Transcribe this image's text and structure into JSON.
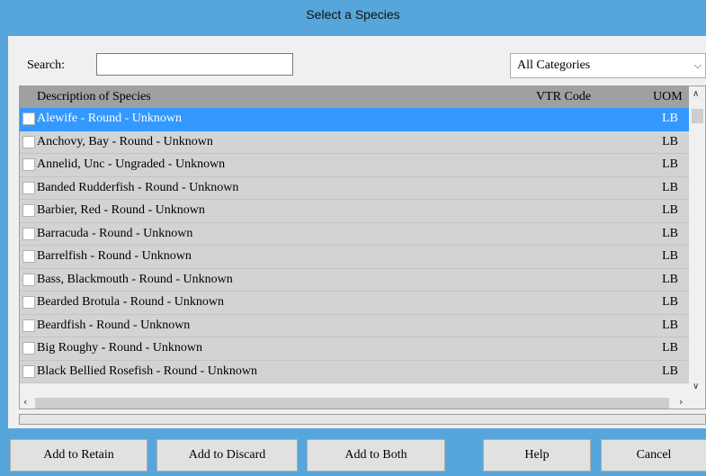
{
  "window": {
    "title": "Select a Species"
  },
  "search": {
    "label": "Search:",
    "value": "",
    "placeholder": ""
  },
  "category_filter": {
    "selected": "All Categories"
  },
  "table": {
    "columns": [
      "Description of Species",
      "VTR Code",
      "UOM"
    ],
    "rows": [
      {
        "description": "Alewife - Round - Unknown",
        "vtr_code": "",
        "uom": "LB",
        "selected": true
      },
      {
        "description": "Anchovy, Bay - Round - Unknown",
        "vtr_code": "",
        "uom": "LB"
      },
      {
        "description": "Annelid, Unc - Ungraded - Unknown",
        "vtr_code": "",
        "uom": "LB"
      },
      {
        "description": "Banded Rudderfish - Round - Unknown",
        "vtr_code": "",
        "uom": "LB"
      },
      {
        "description": "Barbier, Red - Round - Unknown",
        "vtr_code": "",
        "uom": "LB"
      },
      {
        "description": "Barracuda - Round - Unknown",
        "vtr_code": "",
        "uom": "LB"
      },
      {
        "description": "Barrelfish - Round - Unknown",
        "vtr_code": "",
        "uom": "LB"
      },
      {
        "description": "Bass, Blackmouth - Round - Unknown",
        "vtr_code": "",
        "uom": "LB"
      },
      {
        "description": "Bearded Brotula - Round - Unknown",
        "vtr_code": "",
        "uom": "LB"
      },
      {
        "description": "Beardfish - Round - Unknown",
        "vtr_code": "",
        "uom": "LB"
      },
      {
        "description": "Big Roughy - Round - Unknown",
        "vtr_code": "",
        "uom": "LB"
      },
      {
        "description": "Black Bellied Rosefish - Round - Unknown",
        "vtr_code": "",
        "uom": "LB"
      }
    ]
  },
  "icons": {
    "dropdown": "chevron-down-icon",
    "scroll_up": "arrow-up-icon",
    "scroll_down": "arrow-down-icon",
    "scroll_left": "arrow-left-icon",
    "scroll_right": "arrow-right-icon"
  },
  "buttons": {
    "retain": "Add to Retain",
    "discard": "Add to Discard",
    "both": "Add to Both",
    "help": "Help",
    "cancel": "Cancel"
  },
  "colors": {
    "frame": "#56a6dc",
    "selection": "#3399ff",
    "row_bg": "#d3d3d3",
    "header_bg": "#a0a0a0"
  }
}
